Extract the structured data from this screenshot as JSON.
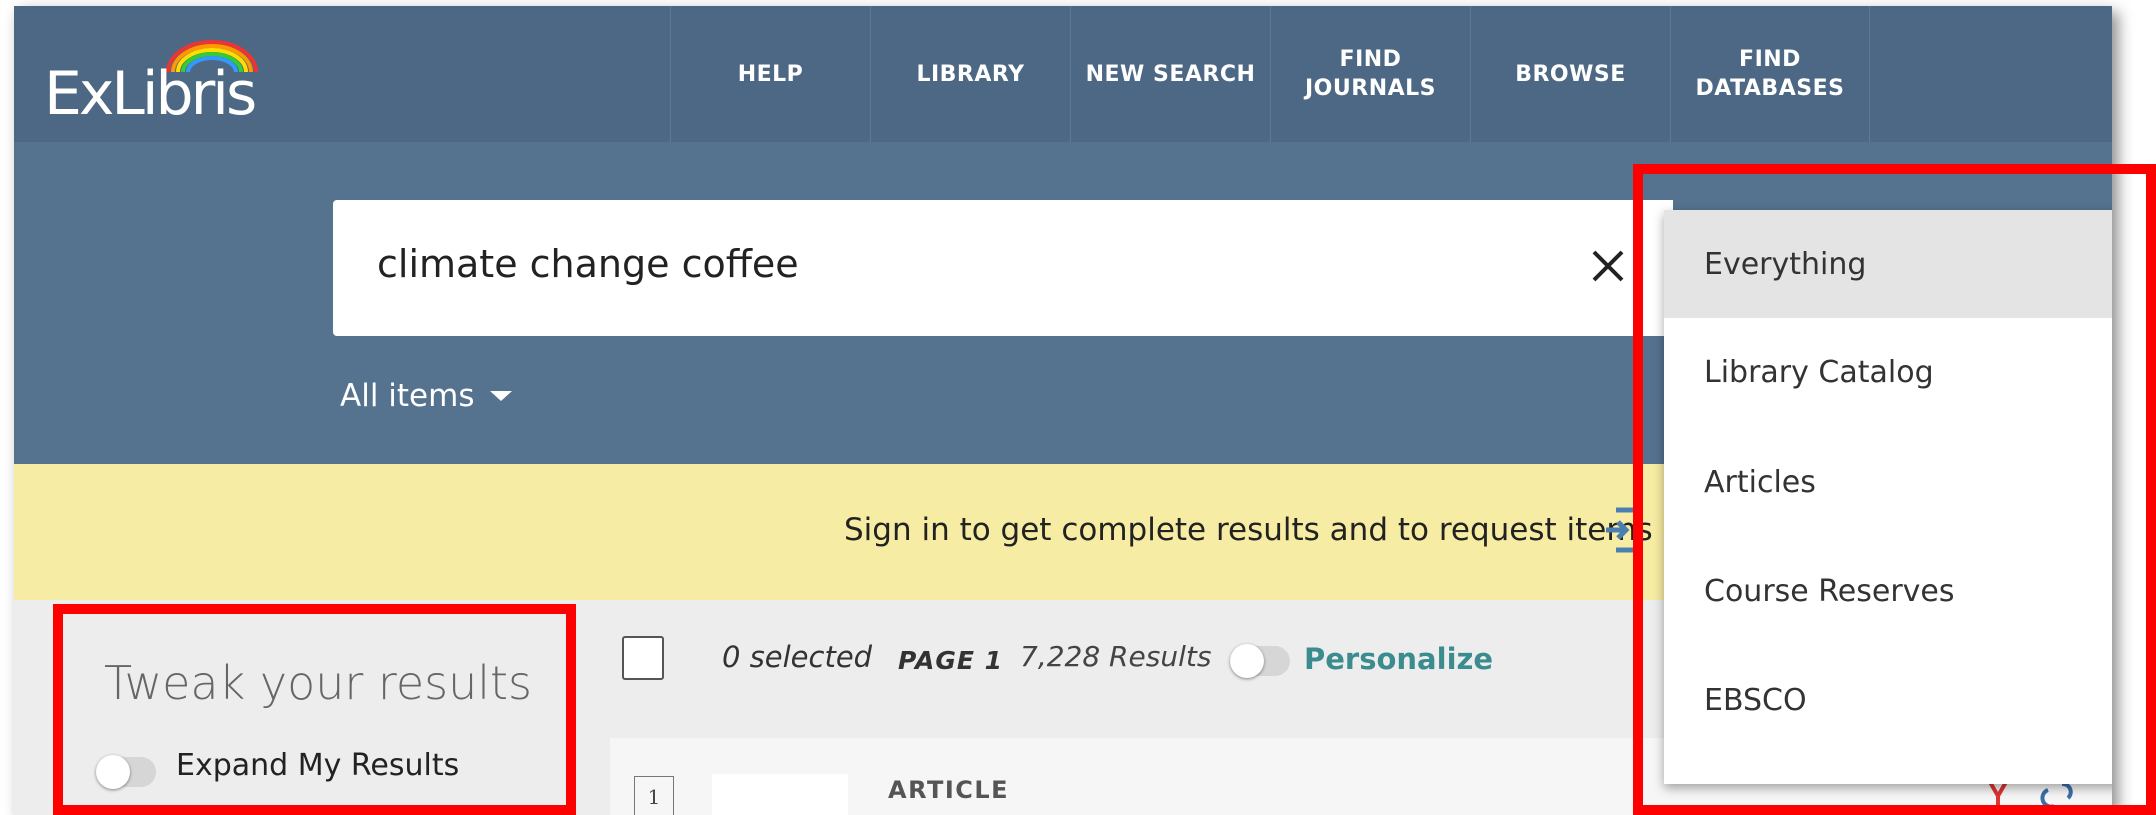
{
  "brand": {
    "logo_text": "ExLibris"
  },
  "nav": [
    "HELP",
    "LIBRARY",
    "NEW SEARCH",
    "FIND\nJOURNALS",
    "BROWSE",
    "FIND\nDATABASES"
  ],
  "search": {
    "query": "climate change coffee",
    "scope": "All items"
  },
  "banner": {
    "text": "Sign in to get complete results and to request items"
  },
  "results_toolbar": {
    "selected": "0 selected",
    "page": "PAGE 1",
    "count": "7,228 Results",
    "personalize": "Personalize"
  },
  "facets": {
    "title": "Tweak your results",
    "expand_label": "Expand My Results"
  },
  "first_result": {
    "number": "1",
    "type": "ARTICLE"
  },
  "scope_dropdown": {
    "options": [
      "Everything",
      "Library Catalog",
      "Articles",
      "Course Reserves",
      "EBSCO"
    ],
    "selected": "Everything"
  },
  "colors": {
    "topbar": "#4d6884",
    "search_band": "#55728f",
    "banner": "#f7eca3",
    "accent_teal": "#3a8c8f",
    "annotation_red": "#ff0000"
  }
}
